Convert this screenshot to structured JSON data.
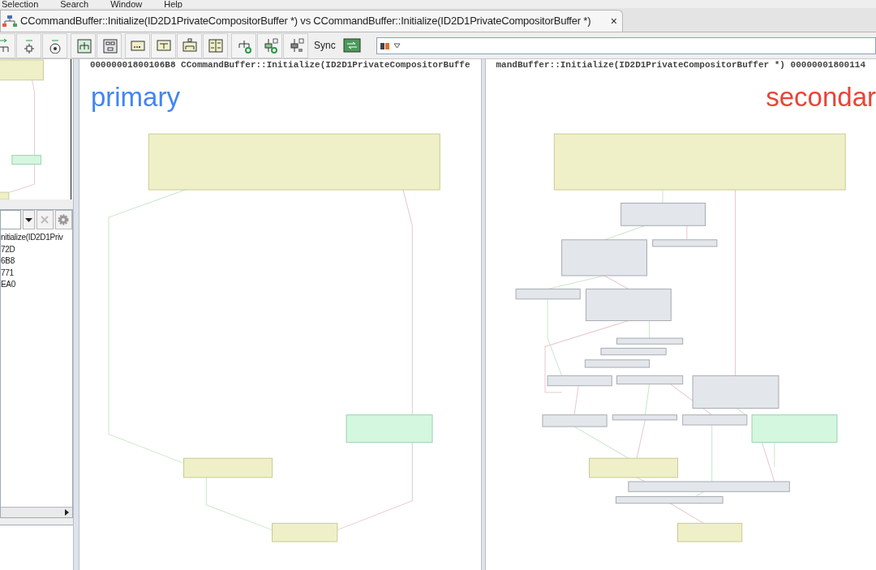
{
  "menu": [
    "Selection",
    "Search",
    "Window",
    "Help"
  ],
  "tab": {
    "title": "CCommandBuffer::Initialize(ID2D1PrivateCompositorBuffer *) vs CCommandBuffer::Initialize(ID2D1PrivateCompositorBuffer *)",
    "close": "×",
    "selected": true
  },
  "toolbar": {
    "sync_label": "Sync"
  },
  "sidebar": {
    "function_list": [
      "nitialize(ID2D1Priv",
      "72D",
      "6B8",
      "771",
      "EA0"
    ]
  },
  "panels": [
    {
      "kind": "primary",
      "header": "00000001800106B8 CCommandBuffer::Initialize(ID2D1PrivateCompositorBuffe",
      "label": "primary"
    },
    {
      "kind": "secondary",
      "header": "mandBuffer::Initialize(ID2D1PrivateCompositorBuffer *) 00000001800114",
      "label": "secondar"
    }
  ]
}
